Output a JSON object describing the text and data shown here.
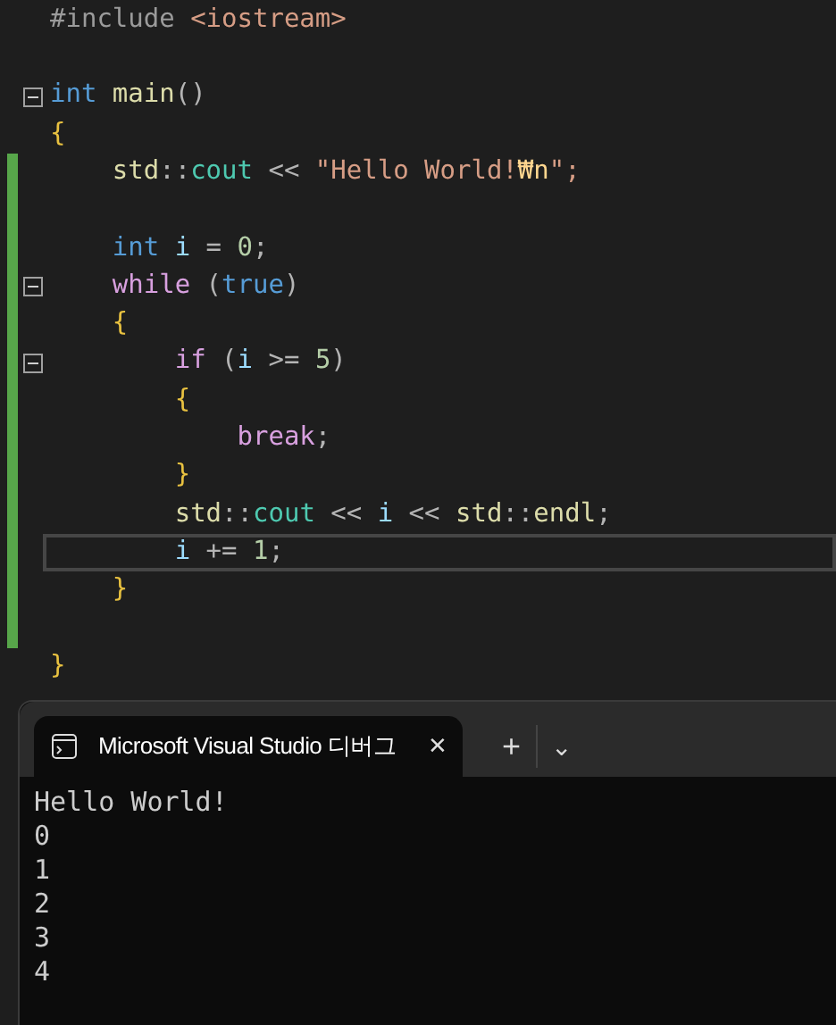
{
  "editor": {
    "lines": [
      {
        "changed": false,
        "current": false,
        "tokens": [
          {
            "text": "#include",
            "kind": "preproc"
          },
          {
            "text": " <iostream>",
            "kind": "header"
          }
        ]
      },
      {
        "changed": false,
        "current": false
      },
      {
        "changed": false,
        "current": false,
        "fold_expanded": true,
        "tokens": [
          {
            "text": "int",
            "kind": "keyword"
          },
          {
            "text": " main",
            "kind": "func"
          },
          {
            "text": "()",
            "kind": "punct"
          }
        ]
      },
      {
        "changed": false,
        "current": false,
        "tokens": [
          {
            "text": "{",
            "kind": "brace"
          }
        ]
      },
      {
        "changed": true,
        "current": false,
        "tokens": [
          {
            "text": "    std",
            "kind": "namespace"
          },
          {
            "text": "::",
            "kind": "punct"
          },
          {
            "text": "cout",
            "kind": "var"
          },
          {
            "text": " << ",
            "kind": "punct"
          },
          {
            "text": "\"Hello World!",
            "kind": "string"
          },
          {
            "text": "₩n",
            "kind": "escape"
          },
          {
            "text": "\";",
            "kind": "string"
          }
        ]
      },
      {
        "changed": true,
        "current": false
      },
      {
        "changed": true,
        "current": false,
        "tokens": [
          {
            "text": "    int",
            "kind": "keyword"
          },
          {
            "text": " i",
            "kind": "ident"
          },
          {
            "text": " = ",
            "kind": "punct"
          },
          {
            "text": "0",
            "kind": "number"
          },
          {
            "text": ";",
            "kind": "punct"
          }
        ]
      },
      {
        "changed": true,
        "current": false,
        "fold_expanded": true,
        "tokens": [
          {
            "text": "    while",
            "kind": "control"
          },
          {
            "text": " (",
            "kind": "punct"
          },
          {
            "text": "true",
            "kind": "keyword"
          },
          {
            "text": ")",
            "kind": "punct"
          }
        ]
      },
      {
        "changed": true,
        "current": false,
        "tokens": [
          {
            "text": "    {",
            "kind": "brace"
          }
        ]
      },
      {
        "changed": true,
        "current": false,
        "fold_expanded": true,
        "tokens": [
          {
            "text": "        if",
            "kind": "control"
          },
          {
            "text": " (",
            "kind": "punct"
          },
          {
            "text": "i",
            "kind": "ident"
          },
          {
            "text": " >= ",
            "kind": "punct"
          },
          {
            "text": "5",
            "kind": "number"
          },
          {
            "text": ")",
            "kind": "punct"
          }
        ]
      },
      {
        "changed": true,
        "current": false,
        "tokens": [
          {
            "text": "        {",
            "kind": "brace"
          }
        ]
      },
      {
        "changed": true,
        "current": false,
        "tokens": [
          {
            "text": "            break",
            "kind": "control"
          },
          {
            "text": ";",
            "kind": "punct"
          }
        ]
      },
      {
        "changed": true,
        "current": false,
        "tokens": [
          {
            "text": "        }",
            "kind": "brace"
          }
        ]
      },
      {
        "changed": true,
        "current": false,
        "tokens": [
          {
            "text": "        std",
            "kind": "namespace"
          },
          {
            "text": "::",
            "kind": "punct"
          },
          {
            "text": "cout",
            "kind": "var"
          },
          {
            "text": " << ",
            "kind": "punct"
          },
          {
            "text": "i",
            "kind": "ident"
          },
          {
            "text": " << ",
            "kind": "punct"
          },
          {
            "text": "std",
            "kind": "namespace"
          },
          {
            "text": "::",
            "kind": "punct"
          },
          {
            "text": "endl",
            "kind": "func"
          },
          {
            "text": ";",
            "kind": "punct"
          }
        ]
      },
      {
        "changed": true,
        "current": true,
        "tokens": [
          {
            "text": "        i",
            "kind": "ident"
          },
          {
            "text": " += ",
            "kind": "punct"
          },
          {
            "text": "1",
            "kind": "number"
          },
          {
            "text": ";",
            "kind": "punct"
          }
        ]
      },
      {
        "changed": true,
        "current": false,
        "tokens": [
          {
            "text": "    }",
            "kind": "brace"
          }
        ]
      },
      {
        "changed": true,
        "current": false
      },
      {
        "changed": false,
        "current": false,
        "tokens": [
          {
            "text": "}",
            "kind": "brace"
          }
        ]
      }
    ]
  },
  "terminal": {
    "tab": {
      "title": "Microsoft Visual Studio 디버그",
      "close": "✕"
    },
    "new_tab": "+",
    "dropdown": "⌄",
    "output": [
      "Hello World!",
      "0",
      "1",
      "2",
      "3",
      "4"
    ]
  }
}
